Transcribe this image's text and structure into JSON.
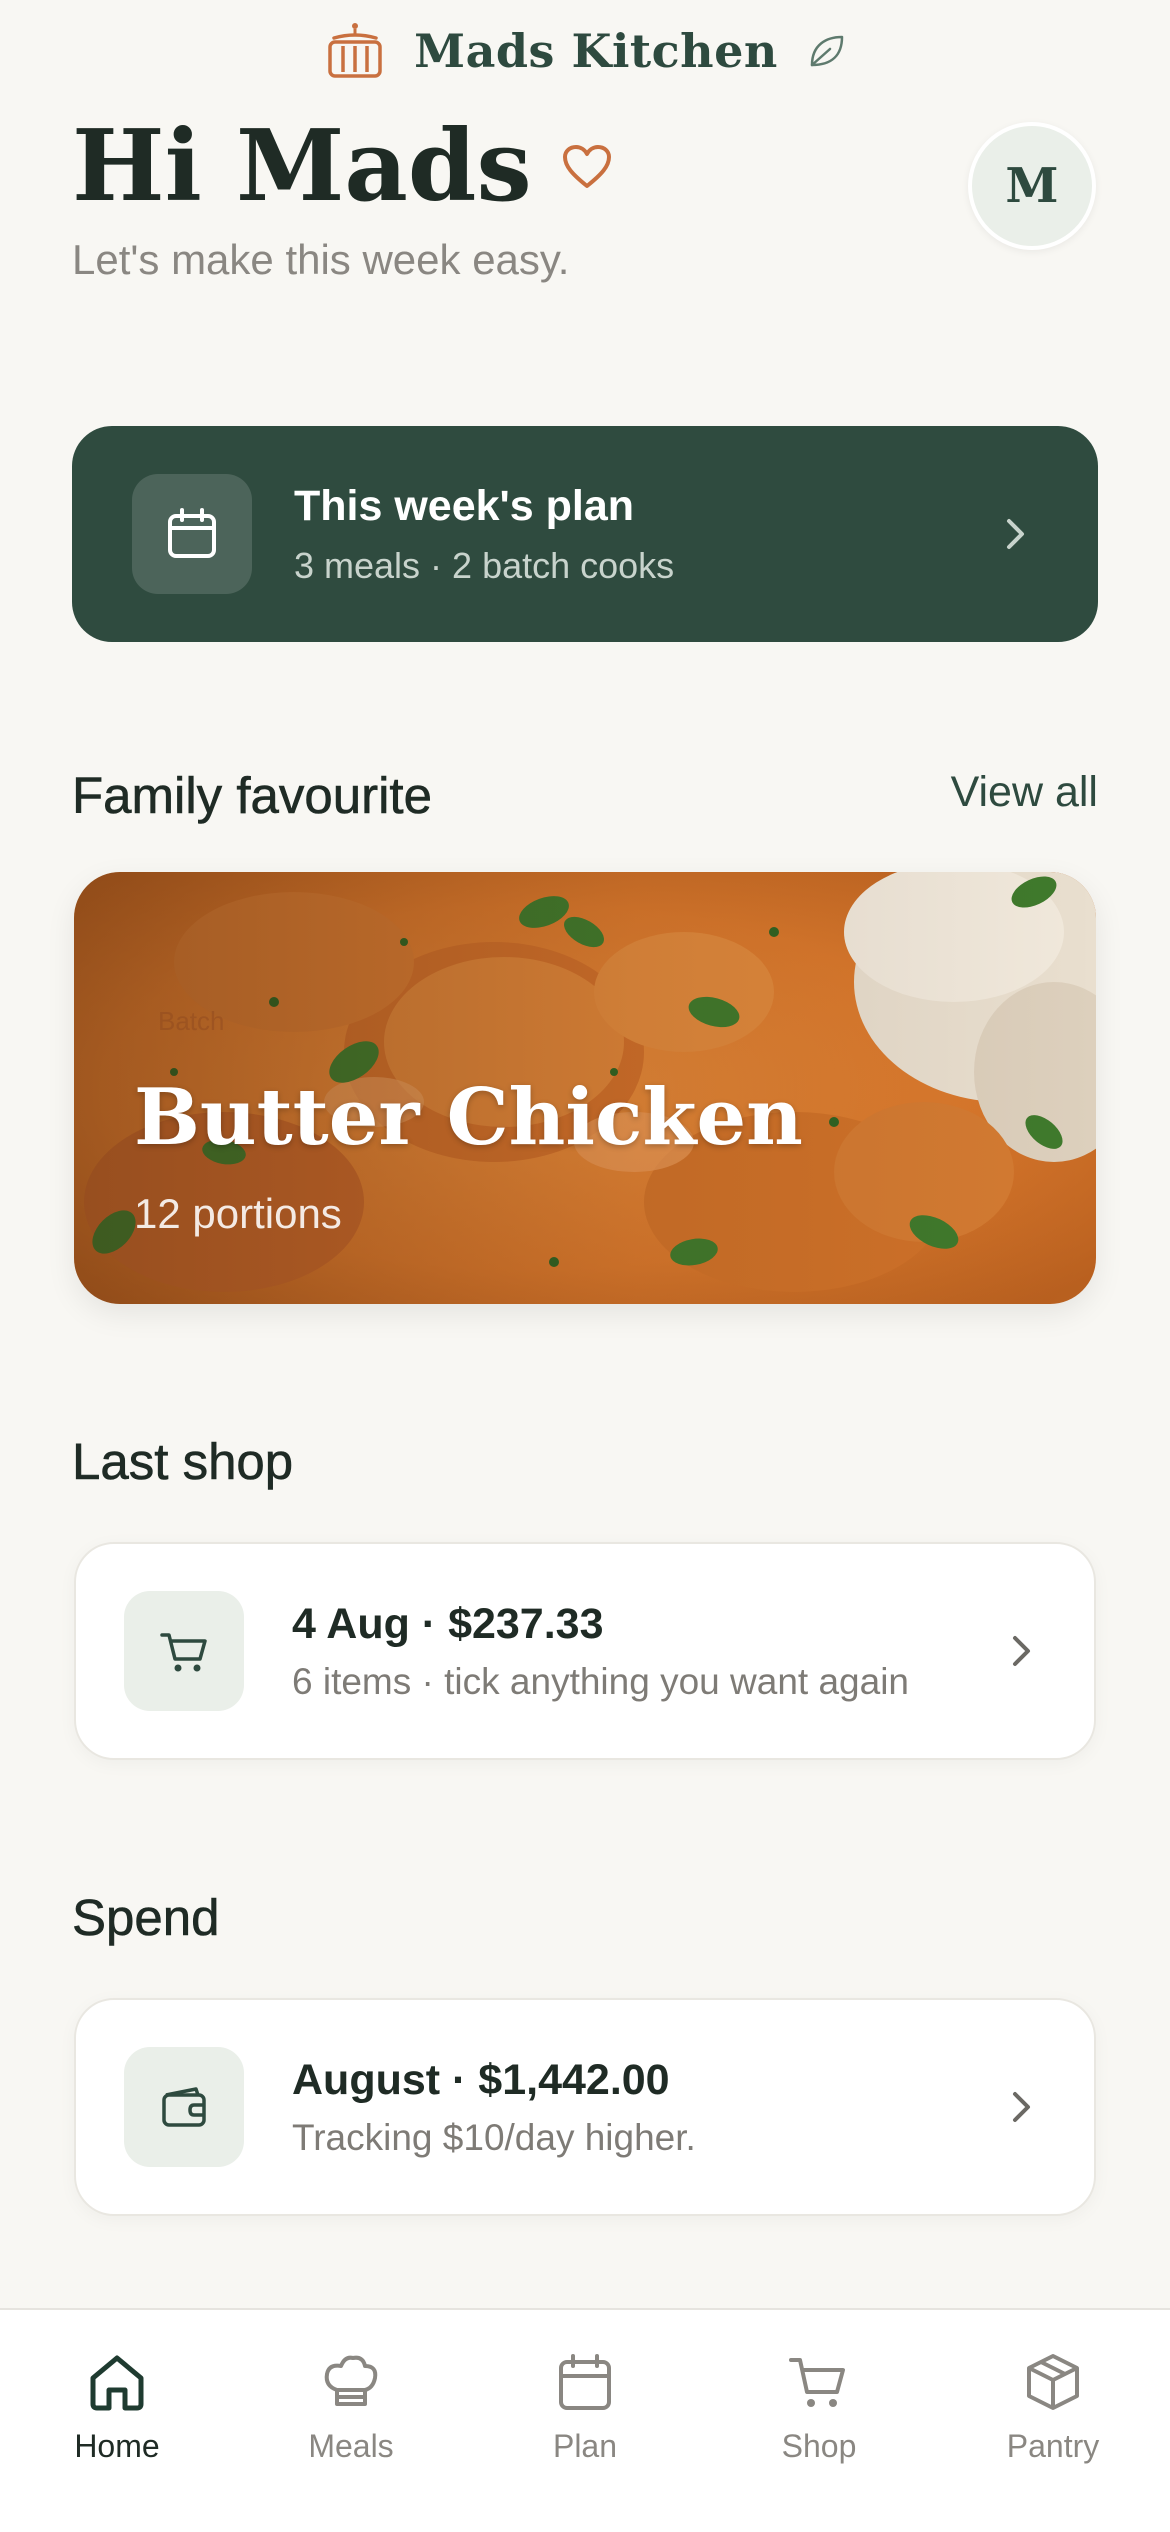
{
  "brand": {
    "name": "Mads Kitchen",
    "logo_icon": "basket-icon",
    "accent_icon": "leaf-icon"
  },
  "greeting": {
    "title": "Hi Mads",
    "icon": "heart-icon",
    "tagline": "Let's make this week easy."
  },
  "avatar": {
    "initial": "M"
  },
  "plan_card": {
    "title": "This week's plan",
    "subtitle": "3 meals · 2 batch cooks",
    "icon": "calendar-icon"
  },
  "favourite": {
    "section_title": "Family favourite",
    "view_all_label": "View all",
    "card": {
      "badge": "Batch",
      "title": "Butter Chicken",
      "subtitle": "12 portions"
    }
  },
  "last_shop": {
    "section_title": "Last shop",
    "title": "4 Aug · $237.33",
    "subtitle": "6 items · tick anything you want again",
    "icon": "cart-icon"
  },
  "spend": {
    "section_title": "Spend",
    "title": "August · $1,442.00",
    "subtitle": "Tracking $10/day higher.",
    "icon": "wallet-icon"
  },
  "tabs": [
    {
      "label": "Home",
      "icon": "home-icon",
      "active": true
    },
    {
      "label": "Meals",
      "icon": "chef-hat-icon",
      "active": false
    },
    {
      "label": "Plan",
      "icon": "calendar-icon",
      "active": false
    },
    {
      "label": "Shop",
      "icon": "cart-icon",
      "active": false
    },
    {
      "label": "Pantry",
      "icon": "box-icon",
      "active": false
    }
  ],
  "colors": {
    "background": "#f8f7f3",
    "primary_green": "#2f4b3f",
    "accent_orange": "#c9703f",
    "text_dark": "#1f2b25",
    "text_muted": "#8a8782"
  }
}
